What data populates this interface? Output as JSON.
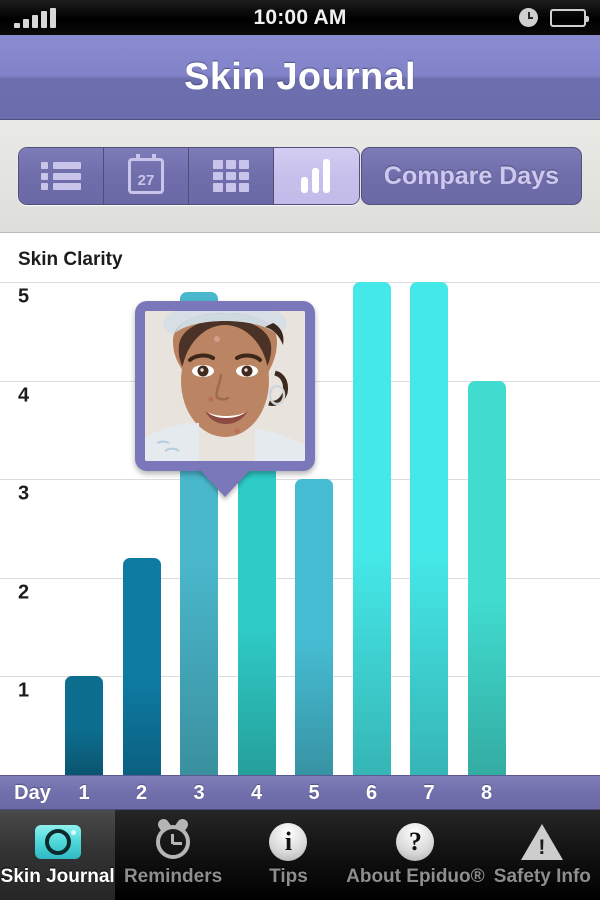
{
  "statusbar": {
    "time": "10:00 AM",
    "signal_icon": "signal-bars-icon",
    "clock_icon": "clock-icon",
    "battery_icon": "battery-icon"
  },
  "navbar": {
    "title": "Skin Journal"
  },
  "toolbar": {
    "segments": [
      {
        "name": "list-view",
        "icon": "list-icon",
        "label": "",
        "active": false
      },
      {
        "name": "calendar-view",
        "icon": "calendar-icon",
        "label": "27",
        "active": false
      },
      {
        "name": "grid-view",
        "icon": "grid-icon",
        "label": "",
        "active": false
      },
      {
        "name": "chart-view",
        "icon": "bar-chart-icon",
        "label": "",
        "active": true
      }
    ],
    "compare_label": "Compare Days"
  },
  "popover": {
    "photo_alt": "face-photo-day-3"
  },
  "chart_data": {
    "type": "bar",
    "title": "Skin Clarity",
    "xlabel": "Day",
    "ylabel": "",
    "categories": [
      "1",
      "2",
      "3",
      "4",
      "5",
      "6",
      "7",
      "8"
    ],
    "values": [
      1,
      2.2,
      4.9,
      3.4,
      3,
      5,
      5,
      4
    ],
    "ylim": [
      0,
      5.5
    ],
    "yticks": [
      1,
      2,
      3,
      4,
      5
    ],
    "grid": true,
    "legend": false,
    "bar_colors": [
      "#0d6d8e",
      "#0e7ba3",
      "#4ab8cc",
      "#2fccc7",
      "#46bcd2",
      "#45e8e8",
      "#45e8e8",
      "#41dcd0"
    ]
  },
  "tabbar": {
    "items": [
      {
        "name": "skin-journal",
        "label": "Skin Journal",
        "icon": "camera-icon",
        "active": true
      },
      {
        "name": "reminders",
        "label": "Reminders",
        "icon": "alarm-clock-icon",
        "active": false
      },
      {
        "name": "tips",
        "label": "Tips",
        "icon": "info-icon",
        "active": false
      },
      {
        "name": "about-epiduo",
        "label": "About Epiduo®",
        "icon": "question-mark-icon",
        "active": false
      },
      {
        "name": "safety-info",
        "label": "Safety Info",
        "icon": "warning-triangle-icon",
        "active": false
      }
    ]
  },
  "colors": {
    "accent_purple": "#6f6eab",
    "accent_light": "#c7c0ec",
    "bar_bright": "#45e8e8"
  }
}
